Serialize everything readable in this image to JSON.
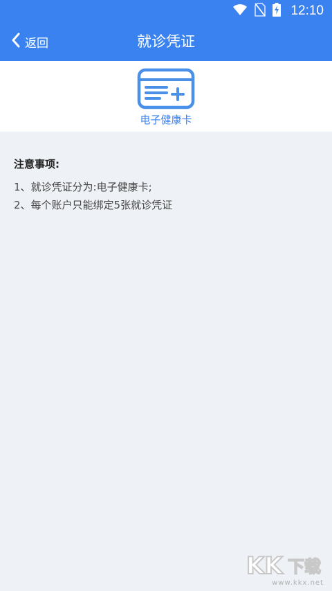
{
  "status_bar": {
    "time": "12:10",
    "icons": [
      "wifi-icon",
      "no-sim-icon",
      "battery-charging-icon"
    ]
  },
  "header": {
    "back_label": "返回",
    "title": "就诊凭证"
  },
  "credential": {
    "icon": "health-card-icon",
    "label": "电子健康卡"
  },
  "notes": {
    "title": "注意事项:",
    "items": [
      "1、就诊凭证分为:电子健康卡;",
      "2、每个账户只能绑定5张就诊凭证"
    ]
  },
  "watermark": {
    "logo_text": "KK下载",
    "url": "www.kkx.net"
  },
  "colors": {
    "primary": "#3a82f0",
    "background": "#eef1f5"
  }
}
